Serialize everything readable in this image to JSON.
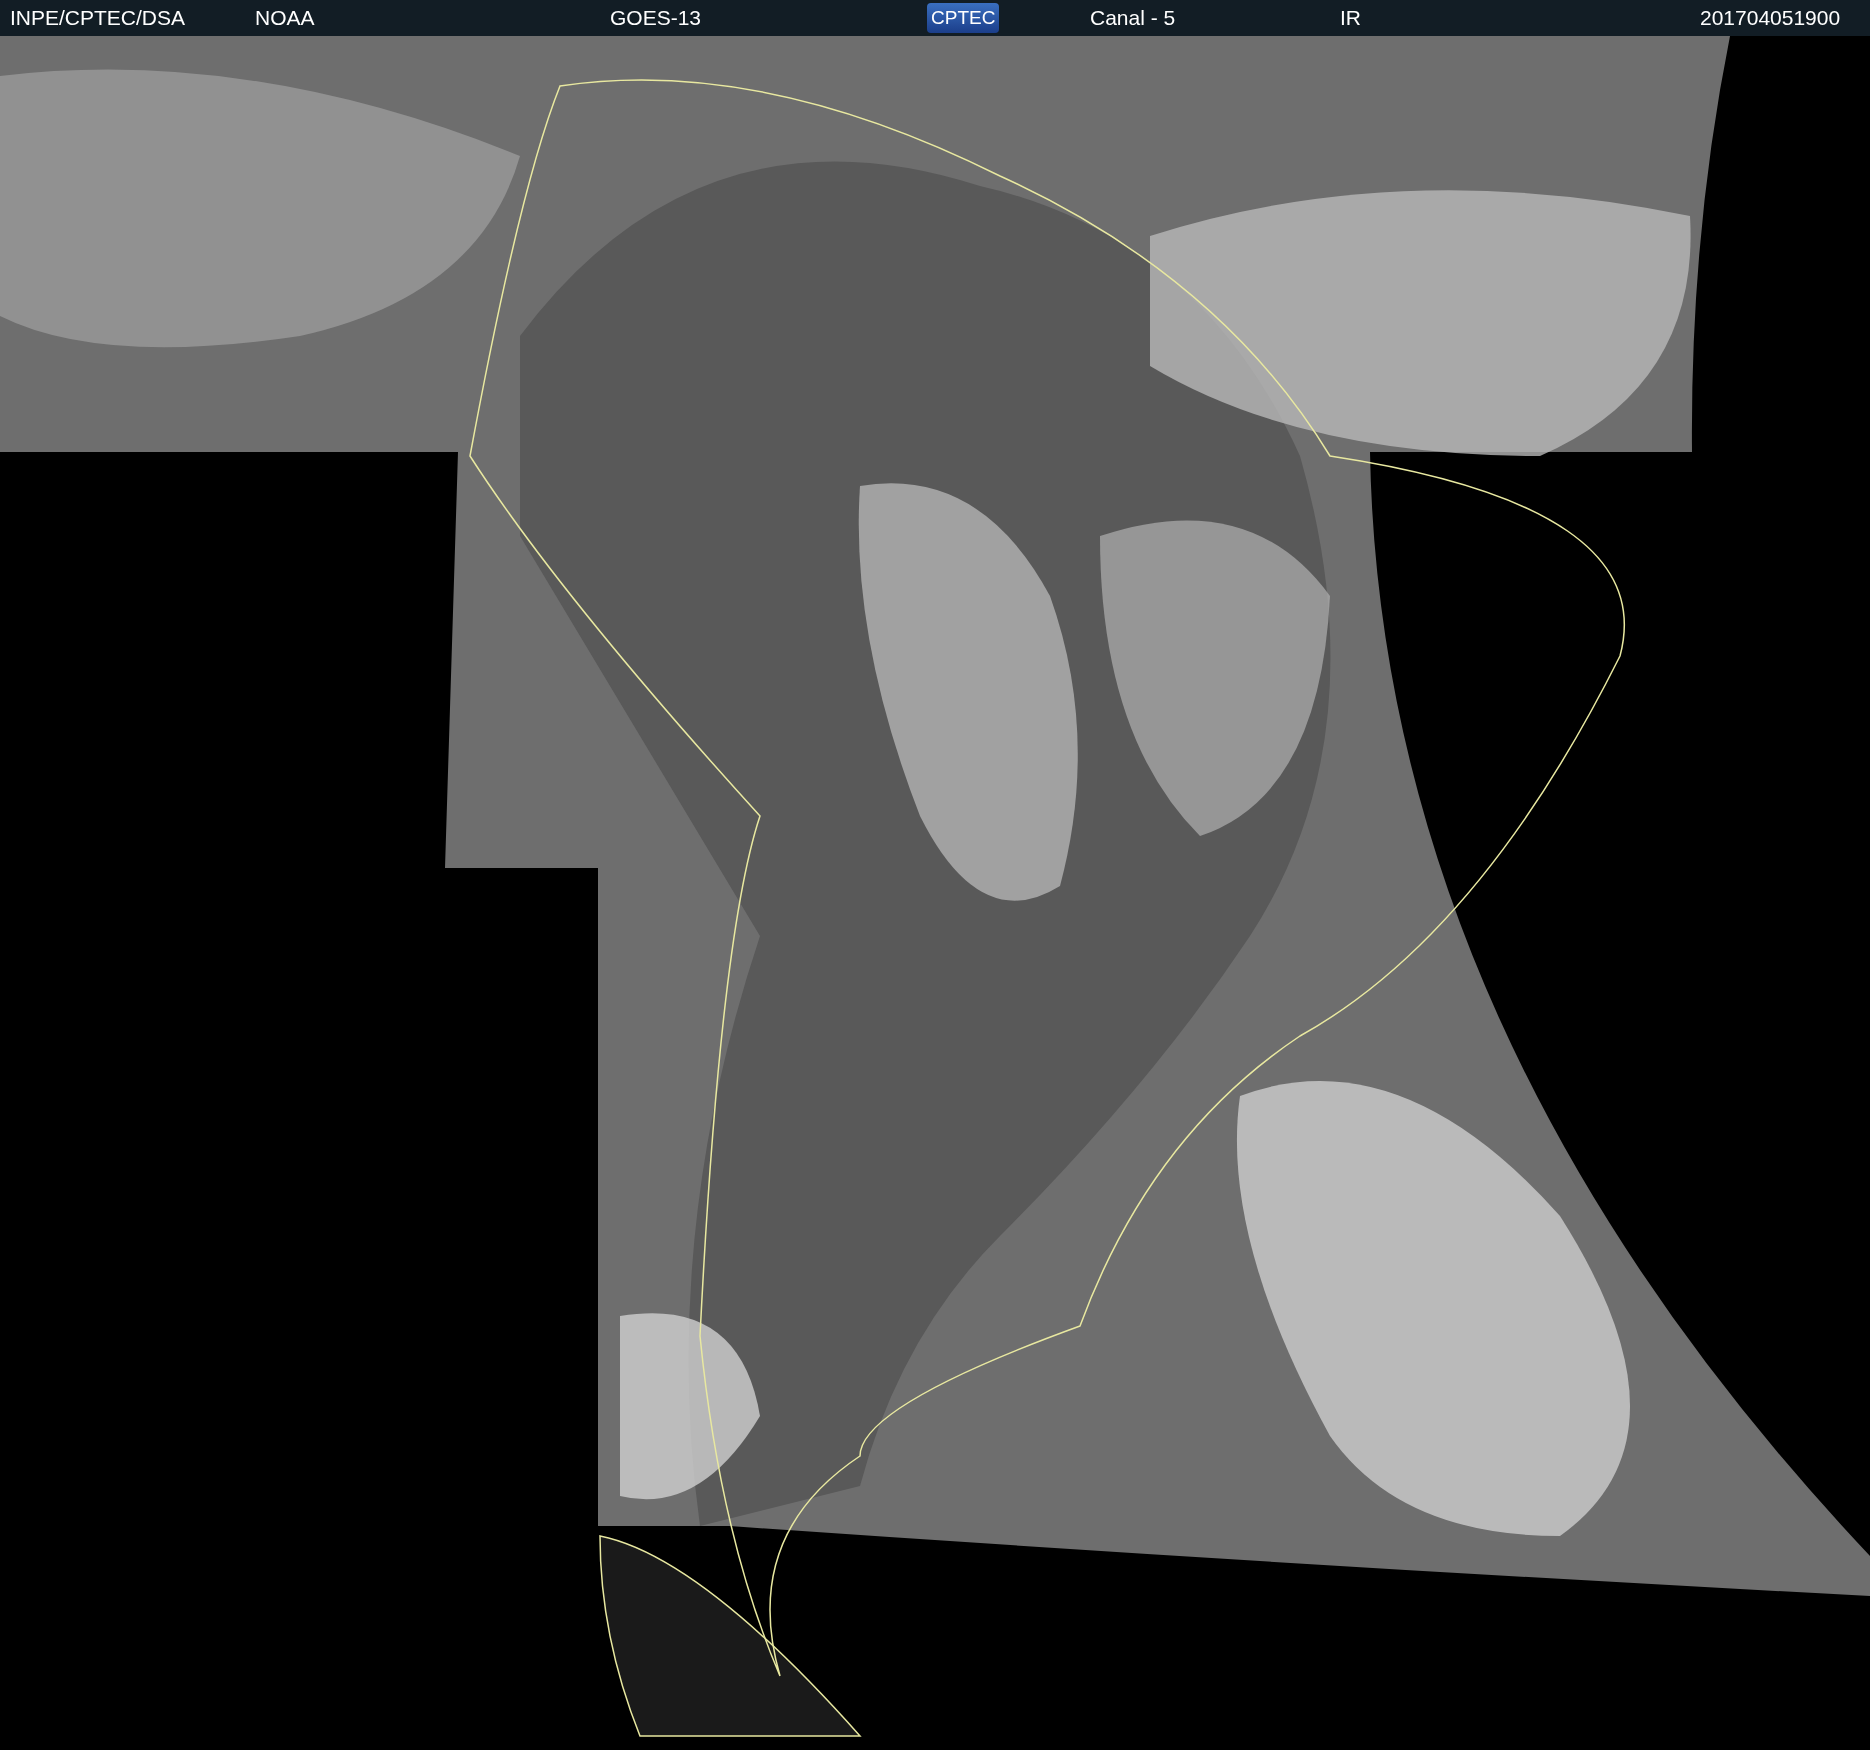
{
  "header": {
    "items": [
      {
        "kind": "text",
        "text": "INPE/CPTEC/DSA"
      },
      {
        "kind": "text",
        "text": "NOAA"
      },
      {
        "kind": "text",
        "text": "GOES-13"
      },
      {
        "kind": "logo",
        "text": "CPTEC"
      },
      {
        "kind": "text",
        "text": "Canal - 5"
      },
      {
        "kind": "text",
        "text": "IR"
      },
      {
        "kind": "text",
        "text": "201704051900"
      }
    ]
  }
}
